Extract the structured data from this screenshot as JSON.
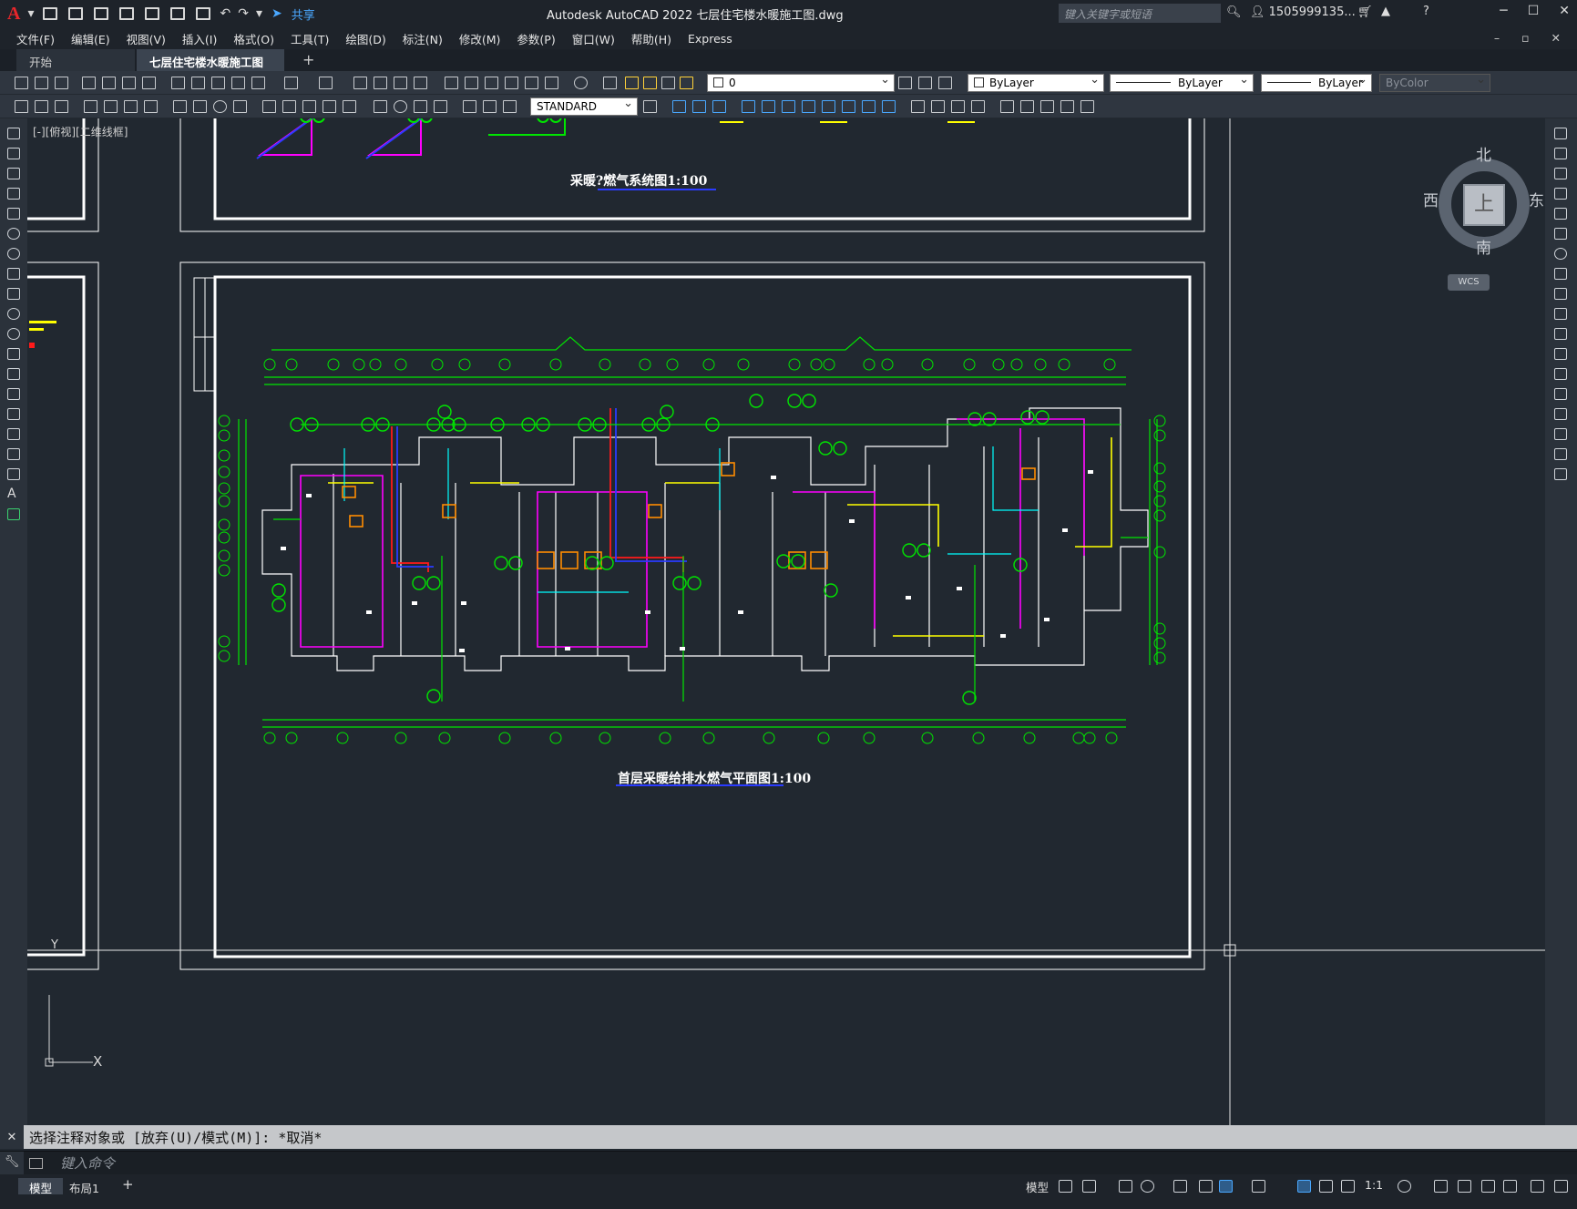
{
  "app": {
    "logo_letter": "A",
    "title": "Autodesk AutoCAD 2022    七层住宅楼水暖施工图.dwg",
    "search_placeholder": "键入关键字或短语",
    "user": "1505999135...",
    "share_label": "共享"
  },
  "menu": [
    "文件(F)",
    "编辑(E)",
    "视图(V)",
    "插入(I)",
    "格式(O)",
    "工具(T)",
    "绘图(D)",
    "标注(N)",
    "修改(M)",
    "参数(P)",
    "窗口(W)",
    "帮助(H)",
    "Express"
  ],
  "tabs": {
    "start": "开始",
    "document": "七层住宅楼水暖施工图*",
    "close_glyph": "✕",
    "add_glyph": "+"
  },
  "toolbar": {
    "layer_value": "0",
    "color_value": "ByLayer",
    "linetype_value": "ByLayer",
    "lineweight_value": "ByLayer",
    "plotstyle_value": "ByColor",
    "textstyle_value": "STANDARD"
  },
  "canvas": {
    "view_label": "[-][俯视][二维线框]",
    "drawing_titles": {
      "upper": "采暖?燃气系统图1:100",
      "lower": "首层采暖给排水燃气平面图1:100"
    },
    "ucs": {
      "x": "X",
      "y": "Y"
    }
  },
  "viewcube": {
    "north": "北",
    "south": "南",
    "east": "东",
    "west": "西",
    "face": "上",
    "wcs": "WCS"
  },
  "command": {
    "history": "选择注释对象或 [放弃(U)/模式(M)]: *取消*",
    "placeholder": "键入命令"
  },
  "status": {
    "layout_model": "模型",
    "layout_1": "布局1",
    "layout_add": "+",
    "model_label": "模型",
    "scale": "1:1"
  },
  "colors": {
    "plan_green": "#00e600",
    "pipe_magenta": "#ff00ff",
    "pipe_red": "#ff1a1a",
    "pipe_yellow": "#ffff00",
    "pipe_blue": "#2a3bff",
    "pipe_cyan": "#00ffff",
    "frame_white": "#ffffff",
    "fixture_orange": "#ff8c00"
  }
}
